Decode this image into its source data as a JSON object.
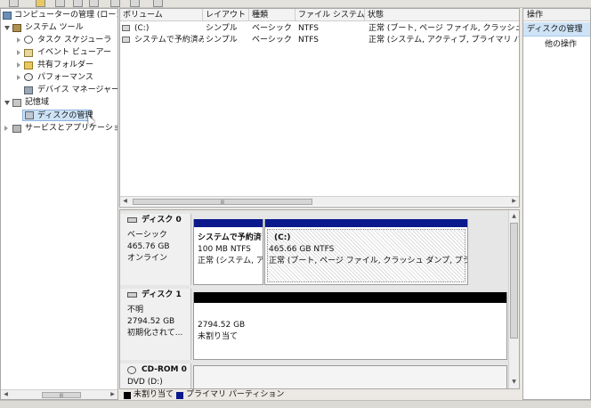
{
  "tree": {
    "root": "コンピューターの管理 (ローカ",
    "system_tools": "システム ツール",
    "task_scheduler": "タスク スケジューラ",
    "event_viewer": "イベント ビューアー",
    "shared_folders": "共有フォルダー",
    "performance": "パフォーマンス",
    "device_manager": "デバイス マネージャー",
    "storage": "記憶域",
    "disk_management": "ディスクの管理",
    "services_apps": "サービスとアプリケーショ"
  },
  "volumes": {
    "columns": [
      "ボリューム",
      "レイアウト",
      "種類",
      "ファイル システム",
      "状態"
    ],
    "rows": [
      {
        "name": "(C:)",
        "layout": "シンプル",
        "type": "ベーシック",
        "fs": "NTFS",
        "status": "正常 (ブート, ページ ファイル, クラッシュ ダ"
      },
      {
        "name": "システムで予約済み",
        "layout": "シンプル",
        "type": "ベーシック",
        "fs": "NTFS",
        "status": "正常 (システム, アクティブ, プライマリ パー"
      }
    ]
  },
  "disks": {
    "disk0": {
      "name": "ディスク 0",
      "type": "ベーシック",
      "size": "465.76 GB",
      "status": "オンライン",
      "partitions": [
        {
          "name": "システムで予約済",
          "detail": "100 MB NTFS",
          "status": "正常 (システム, ア"
        },
        {
          "name": "(C:)",
          "detail": "465.66 GB NTFS",
          "status": "正常 (ブート, ページ ファイル, クラッシュ ダンプ, プラ・"
        }
      ]
    },
    "disk1": {
      "name": "ディスク 1",
      "type": "不明",
      "size": "2794.52 GB",
      "status": "初期化されて...",
      "partition": {
        "size": "2794.52 GB",
        "status": "未割り当て"
      }
    },
    "cdrom0": {
      "name": "CD-ROM 0",
      "type": "DVD (D:)"
    }
  },
  "legend": {
    "unallocated": "未割り当て",
    "primary": "プライマリ パーティション"
  },
  "actions": {
    "header": "操作",
    "section": "ディスクの管理",
    "more": "他の操作"
  },
  "colors": {
    "primary_partition": "#0a1a8c",
    "unallocated": "#000000",
    "selection": "#cfe3f7"
  }
}
